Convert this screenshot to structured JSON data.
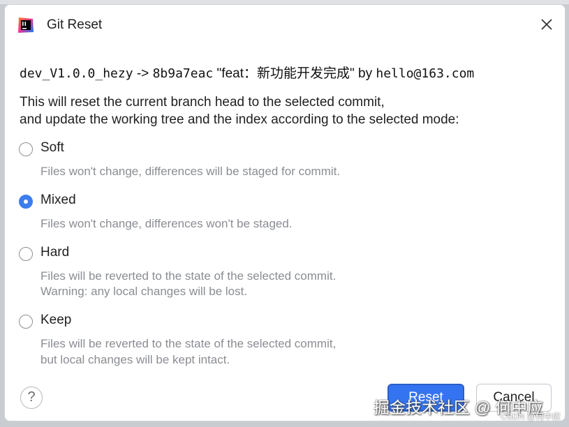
{
  "dialog": {
    "title": "Git Reset",
    "app_icon": "intellij-idea-icon",
    "close_icon": "close-icon"
  },
  "commit": {
    "branch": "dev_V1.0.0_hezy",
    "arrow": "->",
    "hash": "8b9a7eac",
    "message": "\"feat：新功能开发完成\"",
    "by": "by",
    "author": "hello@163.com"
  },
  "description": {
    "line1": "This will reset the current branch head to the selected commit,",
    "line2": "and update the working tree and the index according to the selected mode:"
  },
  "options": [
    {
      "label": "Soft",
      "checked": false,
      "hints": [
        "Files won't change, differences will be staged for commit."
      ]
    },
    {
      "label": "Mixed",
      "checked": true,
      "hints": [
        "Files won't change, differences won't be staged."
      ]
    },
    {
      "label": "Hard",
      "checked": false,
      "hints": [
        "Files will be reverted to the state of the selected commit.",
        "Warning: any local changes will be lost."
      ]
    },
    {
      "label": "Keep",
      "checked": false,
      "hints": [
        "Files will be reverted to the state of the selected commit,",
        "but local changes will be kept intact."
      ]
    }
  ],
  "footer": {
    "help_label": "?",
    "reset_label": "Reset",
    "cancel_label": "Cancel"
  },
  "watermark": {
    "main": "掘金技术社区 @ 何中应",
    "small": "CSDN @何中应"
  },
  "colors": {
    "accent": "#3574f0",
    "radio_checked": "#3c7df0",
    "hint_text": "#8a8d92"
  }
}
